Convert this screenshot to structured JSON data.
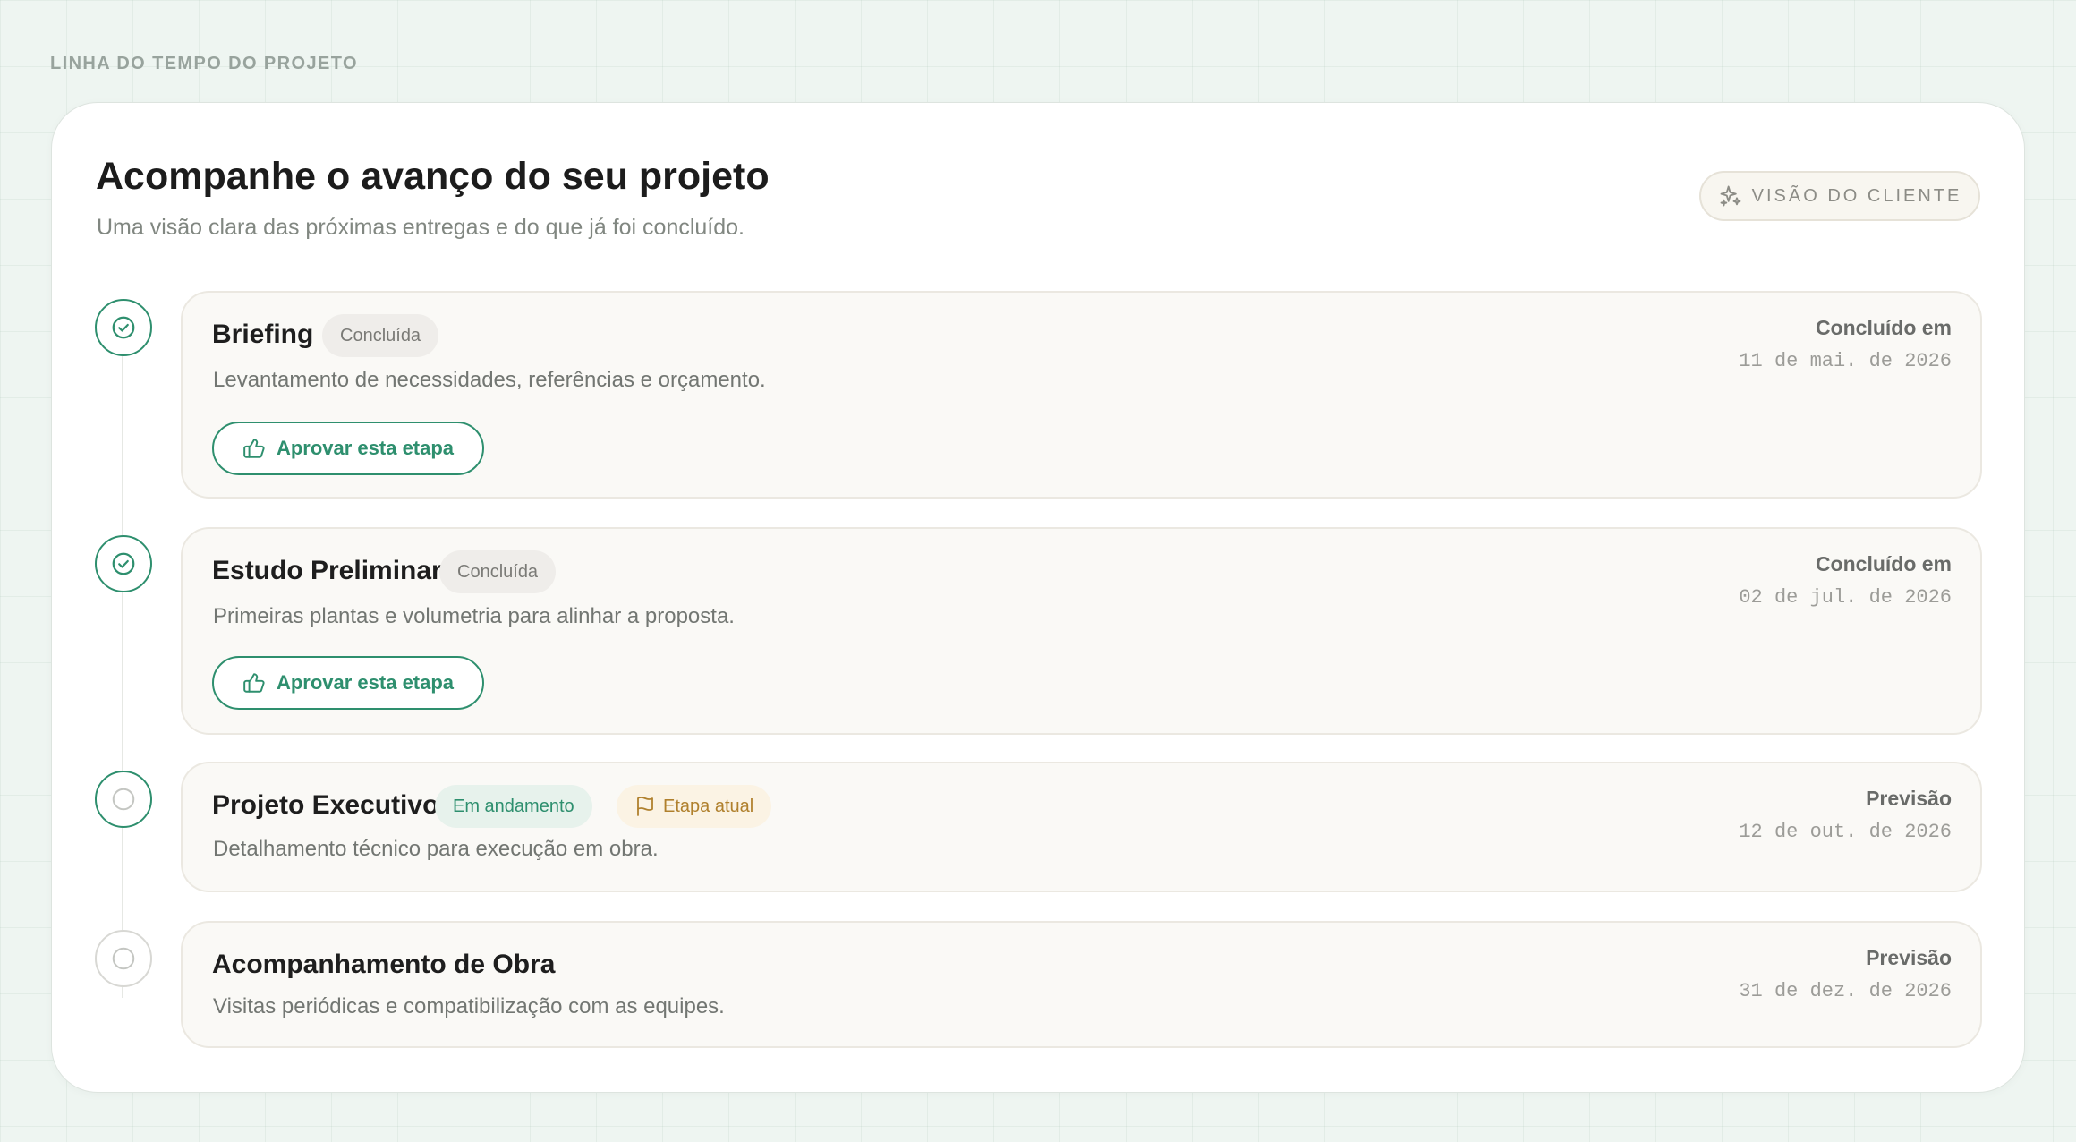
{
  "page_label": "LINHA DO TEMPO DO PROJETO",
  "header": {
    "title": "Acompanhe o avanço do seu projeto",
    "subtitle": "Uma visão clara das próximas entregas e do que já foi concluído.",
    "client_view_label": "VISÃO DO CLIENTE"
  },
  "steps": [
    {
      "title": "Briefing",
      "status": "Concluída",
      "description": "Levantamento de necessidades, referências e orçamento.",
      "date_label": "Concluído em",
      "date": "11 de mai. de 2026",
      "action_label": "Aprovar esta etapa"
    },
    {
      "title": "Estudo Preliminar",
      "status": "Concluída",
      "description": "Primeiras plantas e volumetria para alinhar a proposta.",
      "date_label": "Concluído em",
      "date": "02 de jul. de 2026",
      "action_label": "Aprovar esta etapa"
    },
    {
      "title": "Projeto Executivo",
      "status": "Em andamento",
      "current_label": "Etapa atual",
      "description": "Detalhamento técnico para execução em obra.",
      "date_label": "Previsão",
      "date": "12 de out. de 2026"
    },
    {
      "title": "Acompanhamento de Obra",
      "description": "Visitas periódicas e compatibilização com as equipes.",
      "date_label": "Previsão",
      "date": "31 de dez. de 2026"
    }
  ],
  "colors": {
    "accent": "#2e8f6e",
    "current": "#b0802d",
    "background": "#eef5f1"
  },
  "icons": {
    "client_view": "sparkles-icon",
    "completed": "check-circle-icon",
    "pending": "empty-circle-icon",
    "approve": "thumbs-up-icon",
    "current": "flag-icon"
  }
}
